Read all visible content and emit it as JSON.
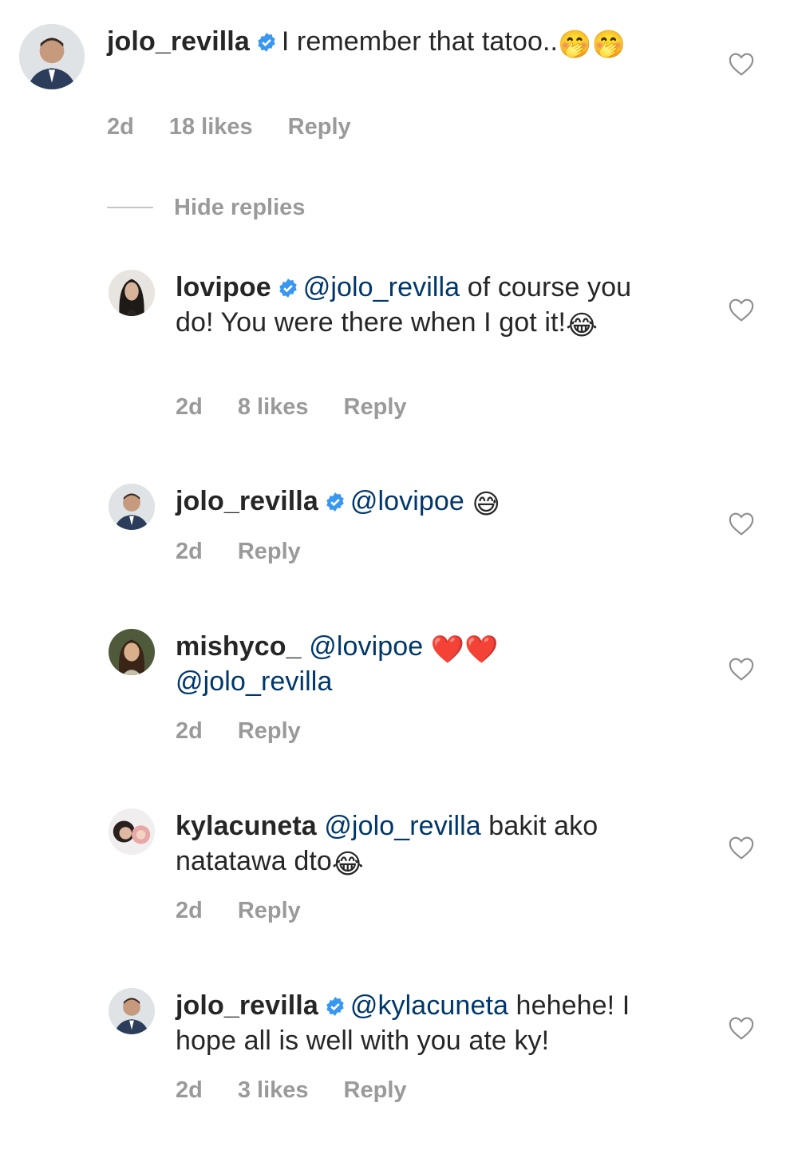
{
  "comments": [
    {
      "username": "jolo_revilla",
      "verified": true,
      "mention": "",
      "text": "I remember that tatoo..",
      "emojis": "🤭🤭",
      "time": "2d",
      "likes": "18 likes",
      "reply": "Reply"
    },
    {
      "username": "lovipoe",
      "verified": true,
      "mention": "@jolo_revilla",
      "text": " of course you do! You were there when I got it!",
      "emojis": "😂",
      "time": "2d",
      "likes": "8 likes",
      "reply": "Reply"
    },
    {
      "username": "jolo_revilla",
      "verified": true,
      "mention": "@lovipoe",
      "text": " ",
      "emojis": "😅",
      "time": "2d",
      "likes": "",
      "reply": "Reply"
    },
    {
      "username": "mishyco_",
      "verified": false,
      "mention": "@lovipoe",
      "text": " ",
      "emojis": "❤️❤️",
      "mention2": "@jolo_revilla",
      "time": "2d",
      "likes": "",
      "reply": "Reply"
    },
    {
      "username": "kylacuneta",
      "verified": false,
      "mention": "@jolo_revilla",
      "text": " bakit ako natatawa dto",
      "emojis": "😂",
      "time": "2d",
      "likes": "",
      "reply": "Reply"
    },
    {
      "username": "jolo_revilla",
      "verified": true,
      "mention": "@kylacuneta",
      "text": " hehehe! I hope all is well with you ate ky!",
      "emojis": "",
      "time": "2d",
      "likes": "3 likes",
      "reply": "Reply"
    }
  ],
  "hide_replies": "Hide replies",
  "icons": {
    "verified": "verified-badge-icon",
    "like": "heart-outline-icon"
  },
  "colors": {
    "verified_blue": "#3897f0",
    "mention": "#00376b",
    "meta_gray": "#9a9a9a"
  }
}
